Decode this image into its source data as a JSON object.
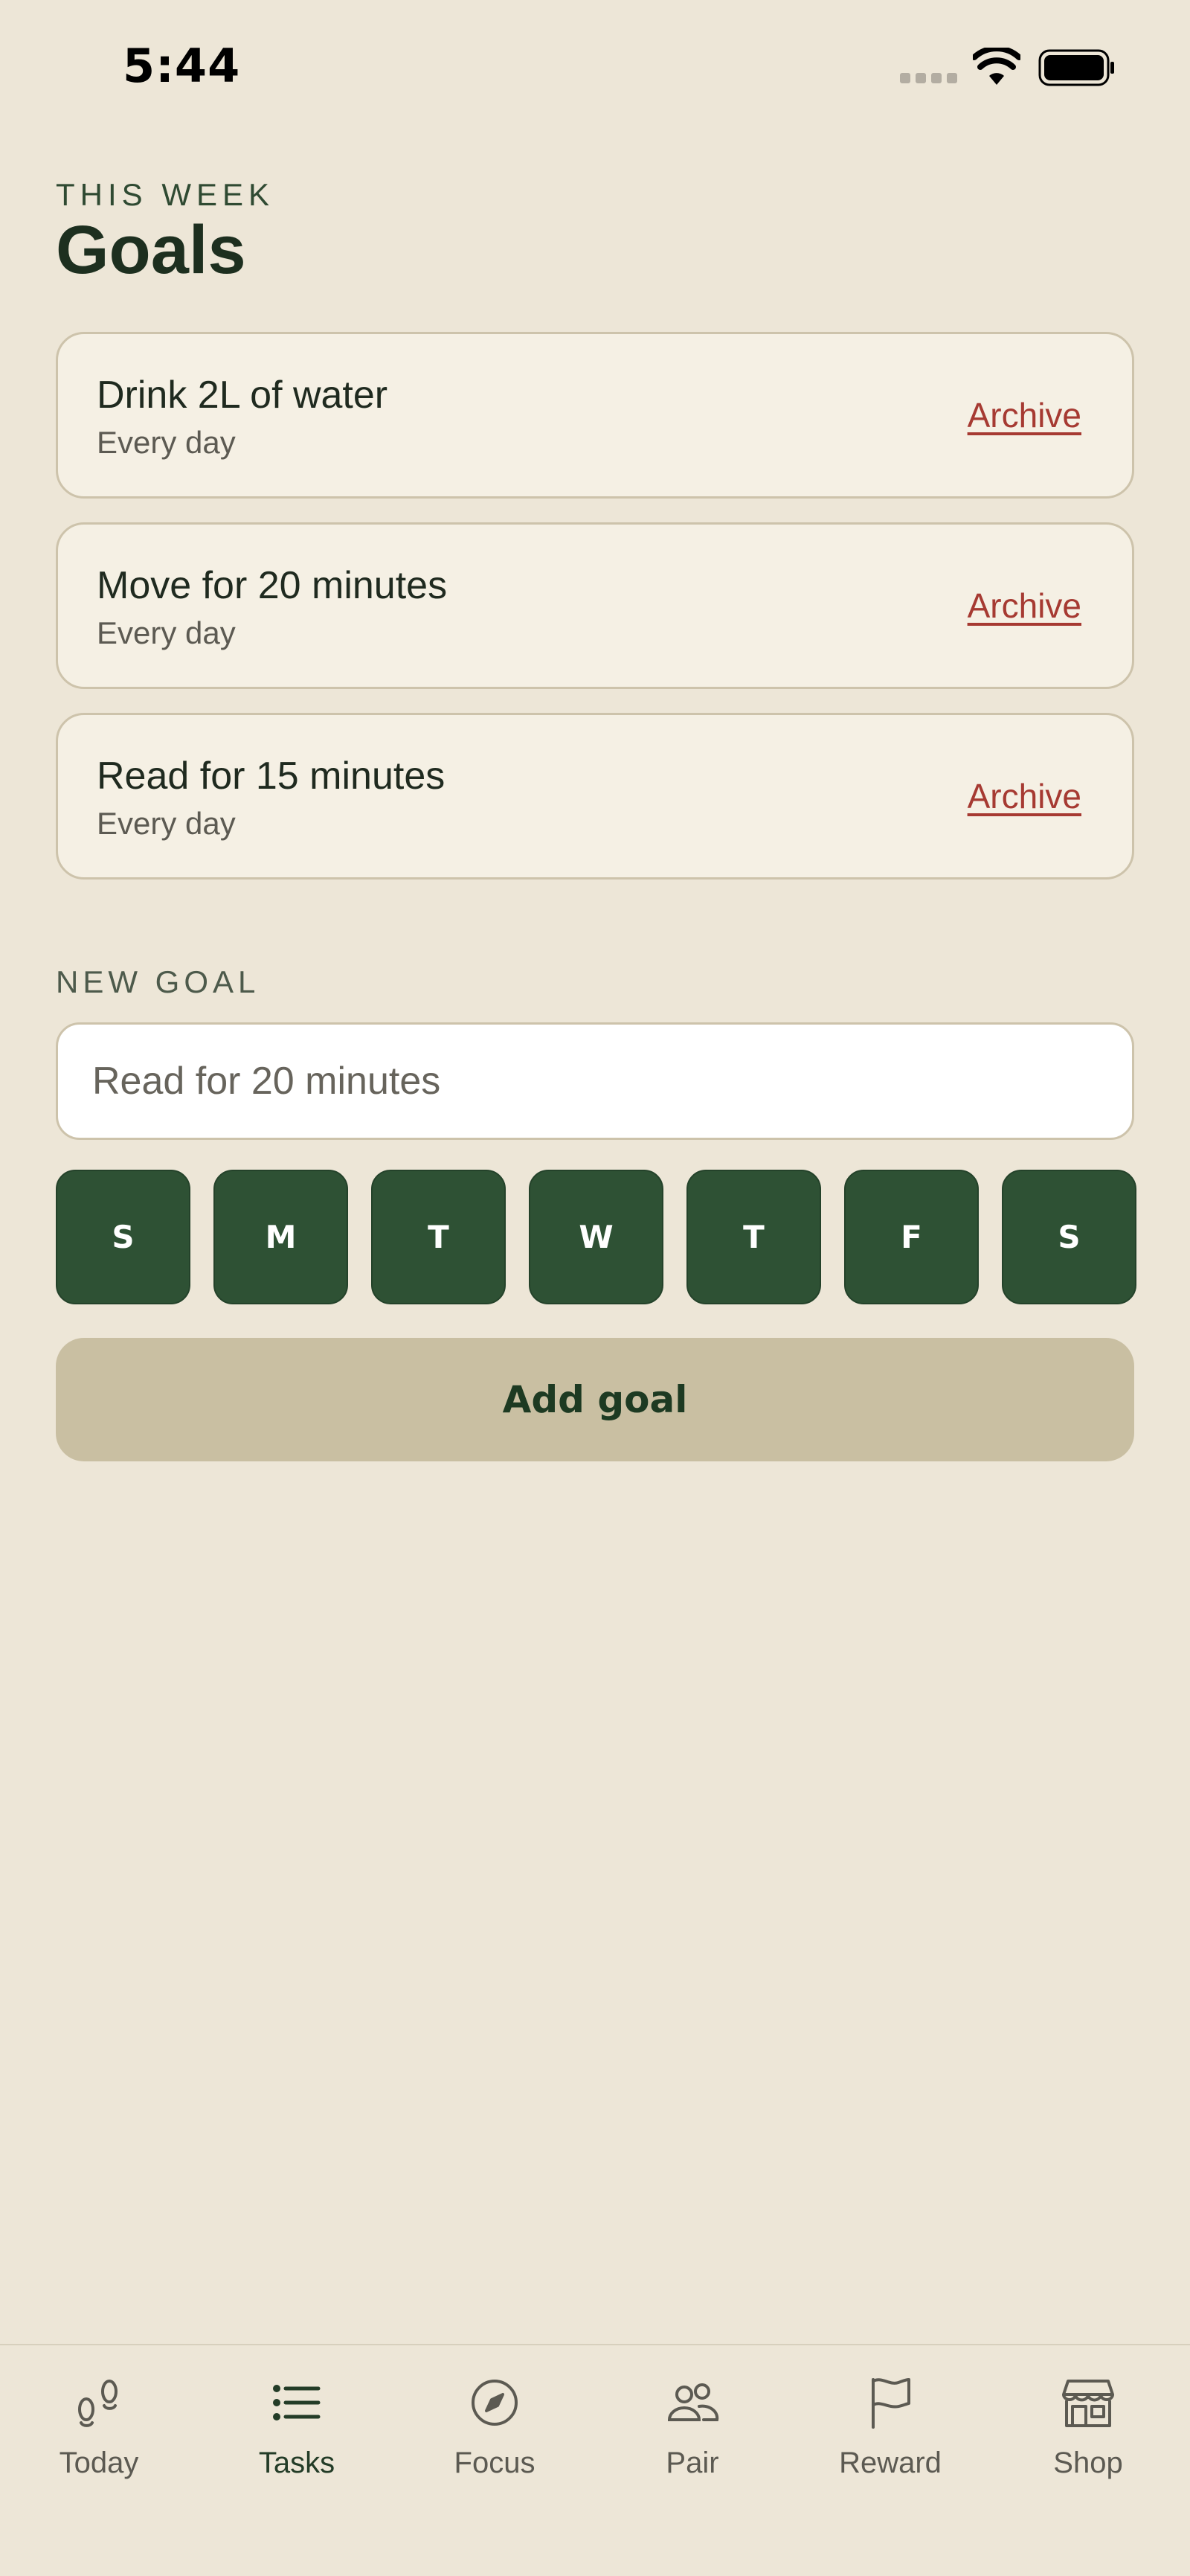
{
  "status_bar": {
    "time": "5:44"
  },
  "header": {
    "eyebrow": "THIS WEEK",
    "title": "Goals"
  },
  "goals": [
    {
      "name": "Drink 2L of water",
      "frequency": "Every day",
      "action": "Archive"
    },
    {
      "name": "Move for 20 minutes",
      "frequency": "Every day",
      "action": "Archive"
    },
    {
      "name": "Read for 15 minutes",
      "frequency": "Every day",
      "action": "Archive"
    }
  ],
  "new_goal": {
    "section_label": "NEW GOAL",
    "placeholder": "Read for 20 minutes",
    "days": [
      "S",
      "M",
      "T",
      "W",
      "T",
      "F",
      "S"
    ],
    "add_label": "Add goal"
  },
  "tabs": [
    {
      "label": "Today",
      "icon": "footsteps-icon"
    },
    {
      "label": "Tasks",
      "icon": "list-icon",
      "active": true
    },
    {
      "label": "Focus",
      "icon": "compass-icon"
    },
    {
      "label": "Pair",
      "icon": "people-icon"
    },
    {
      "label": "Reward",
      "icon": "flag-icon"
    },
    {
      "label": "Shop",
      "icon": "storefront-icon"
    }
  ],
  "colors": {
    "background": "#ede6d7",
    "card": "#f5f0e4",
    "accent_green": "#2e5134",
    "archive_red": "#a63a32",
    "button_beige": "#c9bfa2"
  }
}
